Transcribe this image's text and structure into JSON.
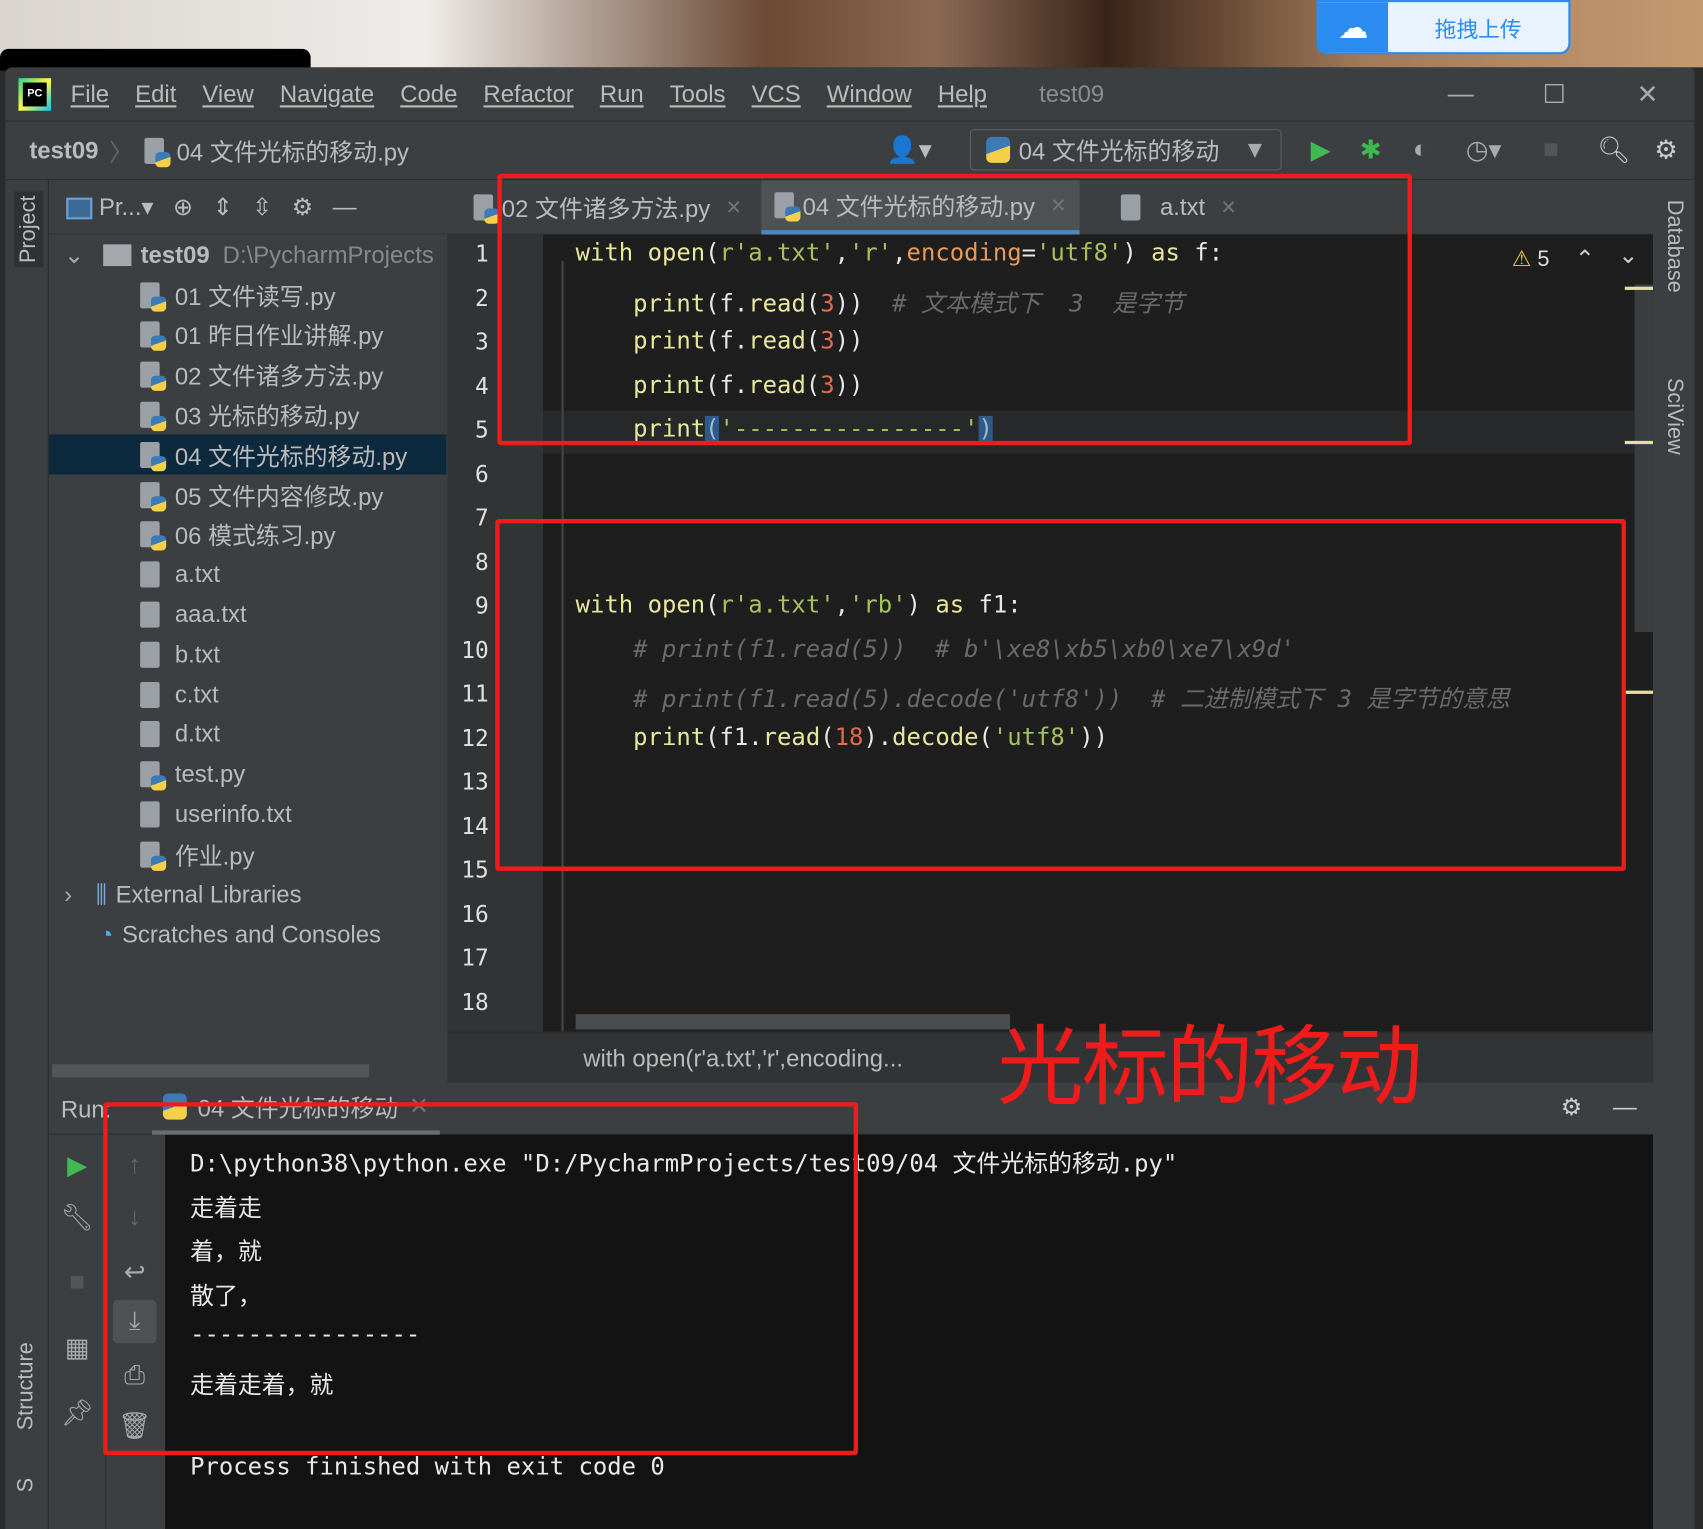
{
  "desktop": {
    "upload_button": "拖拽上传",
    "upload_icon": "cloud-icon"
  },
  "menubar": {
    "logo": "PC",
    "items": [
      "File",
      "Edit",
      "View",
      "Navigate",
      "Code",
      "Refactor",
      "Run",
      "Tools",
      "VCS",
      "Window",
      "Help"
    ],
    "project_title": "test09"
  },
  "navbar": {
    "project": "test09",
    "file": "04 文件光标的移动.py",
    "run_config": "04 文件光标的移动"
  },
  "left_strip": {
    "project": "Project",
    "structure": "Structure",
    "s": "S"
  },
  "right_strip": {
    "database": "Database",
    "sciview": "SciView"
  },
  "project_panel": {
    "header": "Pr...",
    "root": "test09",
    "root_path": "D:\\PycharmProjects",
    "files": [
      {
        "name": "01 文件读写.py",
        "type": "py"
      },
      {
        "name": "01 昨日作业讲解.py",
        "type": "py"
      },
      {
        "name": "02 文件诸多方法.py",
        "type": "py"
      },
      {
        "name": "03 光标的移动.py",
        "type": "py"
      },
      {
        "name": "04 文件光标的移动.py",
        "type": "py",
        "selected": true
      },
      {
        "name": "05 文件内容修改.py",
        "type": "py"
      },
      {
        "name": "06 模式练习.py",
        "type": "py"
      },
      {
        "name": "a.txt",
        "type": "txt"
      },
      {
        "name": "aaa.txt",
        "type": "txt"
      },
      {
        "name": "b.txt",
        "type": "txt"
      },
      {
        "name": "c.txt",
        "type": "txt"
      },
      {
        "name": "d.txt",
        "type": "txt"
      },
      {
        "name": "test.py",
        "type": "py"
      },
      {
        "name": "userinfo.txt",
        "type": "txt"
      },
      {
        "name": "作业.py",
        "type": "py"
      }
    ],
    "external_libraries": "External Libraries",
    "scratches": "Scratches and Consoles"
  },
  "editor": {
    "tabs": [
      {
        "label": "02 文件诸多方法.py",
        "active": false
      },
      {
        "label": "04 文件光标的移动.py",
        "active": true
      },
      {
        "label": "a.txt",
        "active": false
      }
    ],
    "warnings": "5",
    "line_numbers": [
      "1",
      "2",
      "3",
      "4",
      "5",
      "6",
      "7",
      "8",
      "9",
      "10",
      "11",
      "12",
      "13",
      "14",
      "15",
      "16",
      "17",
      "18"
    ],
    "lines": [
      [
        [
          "with ",
          "kw"
        ],
        [
          "open",
          "fn"
        ],
        [
          "(",
          "pl"
        ],
        [
          "r'a.txt'",
          "str"
        ],
        [
          ",",
          "pl"
        ],
        [
          "'r'",
          "str"
        ],
        [
          ",",
          "pl"
        ],
        [
          "encoding",
          "prm"
        ],
        [
          "=",
          "pl"
        ],
        [
          "'utf8'",
          "str"
        ],
        [
          ") ",
          "pl"
        ],
        [
          "as ",
          "kw"
        ],
        [
          "f:",
          "pl"
        ]
      ],
      [
        [
          "    print",
          "fn"
        ],
        [
          "(f.",
          "pl"
        ],
        [
          "read",
          "fn"
        ],
        [
          "(",
          "pl"
        ],
        [
          "3",
          "num"
        ],
        [
          "))  ",
          "pl"
        ],
        [
          "# 文本模式下  3  是字节",
          "cm"
        ]
      ],
      [
        [
          "    print",
          "fn"
        ],
        [
          "(f.",
          "pl"
        ],
        [
          "read",
          "fn"
        ],
        [
          "(",
          "pl"
        ],
        [
          "3",
          "num"
        ],
        [
          "))",
          "pl"
        ]
      ],
      [
        [
          "    print",
          "fn"
        ],
        [
          "(f.",
          "pl"
        ],
        [
          "read",
          "fn"
        ],
        [
          "(",
          "pl"
        ],
        [
          "3",
          "num"
        ],
        [
          "))",
          "pl"
        ]
      ],
      [
        [
          "    print",
          "fn"
        ],
        [
          "(",
          "brk"
        ],
        [
          "'----------------'",
          "str"
        ],
        [
          ")",
          "brk"
        ]
      ],
      [],
      [],
      [],
      [
        [
          "with ",
          "kw"
        ],
        [
          "open",
          "fn"
        ],
        [
          "(",
          "pl"
        ],
        [
          "r'a.txt'",
          "str"
        ],
        [
          ",",
          "pl"
        ],
        [
          "'rb'",
          "str"
        ],
        [
          ") ",
          "pl"
        ],
        [
          "as ",
          "kw"
        ],
        [
          "f1:",
          "pl"
        ]
      ],
      [
        [
          "    # print(f1.read(5))  # b'\\xe8\\xb5\\xb0\\xe7\\x9d'",
          "cm"
        ]
      ],
      [
        [
          "    # print(f1.read(5).decode('utf8'))  # 二进制模式下 3 是字节的意思",
          "cm"
        ]
      ],
      [
        [
          "    print",
          "fn"
        ],
        [
          "(f1.",
          "pl"
        ],
        [
          "read",
          "fn"
        ],
        [
          "(",
          "pl"
        ],
        [
          "18",
          "num"
        ],
        [
          ").",
          "pl"
        ],
        [
          "decode",
          "fn"
        ],
        [
          "(",
          "pl"
        ],
        [
          "'utf8'",
          "str"
        ],
        [
          "))",
          "pl"
        ]
      ],
      [],
      [],
      [],
      [],
      [],
      []
    ],
    "breadcrumb": "with open(r'a.txt','r',encoding..."
  },
  "run": {
    "label": "Run:",
    "tab": "04 文件光标的移动",
    "output": [
      "D:\\python38\\python.exe \"D:/PycharmProjects/test09/04 文件光标的移动.py\"",
      "走着走",
      "着，就",
      "散了，",
      "----------------",
      "走着走着，就",
      "",
      "Process finished with exit code 0"
    ]
  },
  "annotation": "光标的移动",
  "colors": {
    "annotation": "#f01c1c",
    "accent": "#4a88c7",
    "run_green": "#3fb950"
  }
}
